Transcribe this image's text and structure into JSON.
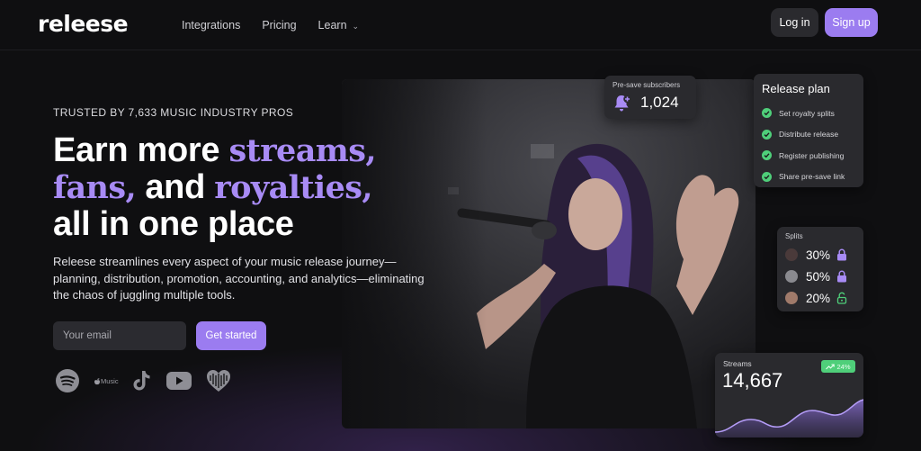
{
  "nav": {
    "logo": "releese",
    "links": [
      {
        "label": "Integrations"
      },
      {
        "label": "Pricing"
      },
      {
        "label": "Learn",
        "icon": "chevron-down-icon"
      }
    ],
    "login_label": "Log in",
    "signup_label": "Sign up"
  },
  "hero": {
    "trusted": "TRUSTED BY 7,633 MUSIC INDUSTRY PROS",
    "headline": {
      "part1": "Earn more ",
      "accent1": "streams,",
      "accent2": "fans,",
      "part2": " and ",
      "accent3": "royalties,",
      "part3": "all in one place"
    },
    "description": "Releese streamlines every aspect of your music release journey—planning, distribution, promotion, accounting, and analytics—eliminating the chaos of juggling multiple tools.",
    "email_placeholder": "Your email",
    "cta_label": "Get started",
    "platforms": [
      {
        "icon": "spotify-icon"
      },
      {
        "icon": "apple-music-icon",
        "label": "Music"
      },
      {
        "icon": "tiktok-icon"
      },
      {
        "icon": "youtube-icon"
      },
      {
        "icon": "deezer-icon"
      }
    ]
  },
  "cards": {
    "presave": {
      "label": "Pre-save subscribers",
      "count": "1,024",
      "icon": "bell-plus-icon"
    },
    "release_plan": {
      "title": "Release plan",
      "items": [
        "Set royalty splits",
        "Distribute release",
        "Register publishing",
        "Share pre-save link"
      ]
    },
    "splits": {
      "title": "Splits",
      "rows": [
        {
          "pct": "30%",
          "locked": true
        },
        {
          "pct": "50%",
          "locked": true
        },
        {
          "pct": "20%",
          "locked": false
        }
      ]
    },
    "streams": {
      "label": "Streams",
      "count": "14,667",
      "badge": "24%"
    }
  },
  "colors": {
    "accent": "#9b7cf0",
    "accent_text": "#a88bf5",
    "success": "#4fcf7a",
    "card_bg": "#2a2a2e",
    "page_bg": "#0f0f11"
  }
}
